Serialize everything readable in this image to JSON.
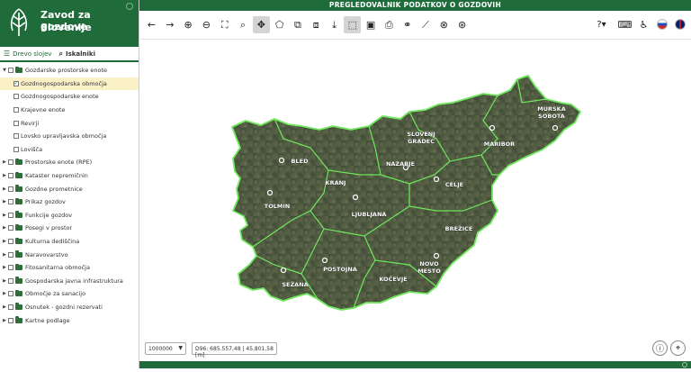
{
  "brand": {
    "line1": "Zavod za gozdove",
    "line2": "Slovenije"
  },
  "header_title": "PREGLEDOVALNIK PODATKOV O GOZDOVIH",
  "tabs": [
    {
      "label": "Drevo slojev",
      "icon": "tree-list-icon"
    },
    {
      "label": "Iskalniki",
      "icon": "search-icon"
    }
  ],
  "tree": [
    {
      "label": "Gozdarske prostorske enote",
      "kind": "group",
      "expanded": true
    },
    {
      "label": "Gozdnogospodarska območja",
      "kind": "layer",
      "checked": true,
      "selected": true
    },
    {
      "label": "Gozdnogospodarske enote",
      "kind": "layer",
      "checked": false
    },
    {
      "label": "Krajevne enote",
      "kind": "layer",
      "checked": false
    },
    {
      "label": "Revirji",
      "kind": "layer",
      "checked": false
    },
    {
      "label": "Lovsko upravljavska območja",
      "kind": "layer",
      "checked": false
    },
    {
      "label": "Lovišča",
      "kind": "layer",
      "checked": false
    },
    {
      "label": "Prostorske enote (RPE)",
      "kind": "group"
    },
    {
      "label": "Kataster nepremičnin",
      "kind": "group"
    },
    {
      "label": "Gozdne prometnice",
      "kind": "group"
    },
    {
      "label": "Prikaz gozdov",
      "kind": "group"
    },
    {
      "label": "Funkcije gozdov",
      "kind": "group"
    },
    {
      "label": "Posegi v prostor",
      "kind": "group"
    },
    {
      "label": "Kulturna dediščina",
      "kind": "group"
    },
    {
      "label": "Naravovarstvo",
      "kind": "group"
    },
    {
      "label": "Fitosanitarna območja",
      "kind": "group"
    },
    {
      "label": "Gospodarska javna infrastruktura",
      "kind": "group"
    },
    {
      "label": "Območje za sanacijo",
      "kind": "group"
    },
    {
      "label": "Osnutek - gozdni rezervati",
      "kind": "group"
    },
    {
      "label": "Kartne podlage",
      "kind": "group"
    }
  ],
  "toolbar": {
    "left": [
      {
        "name": "back-arrow-icon",
        "glyph": "←"
      },
      {
        "name": "forward-arrow-icon",
        "glyph": "→"
      },
      {
        "name": "zoom-in-icon",
        "glyph": "⊕"
      },
      {
        "name": "zoom-out-icon",
        "glyph": "⊖"
      },
      {
        "name": "full-extent-icon",
        "glyph": "⛶"
      },
      {
        "name": "zoom-to-box-icon",
        "glyph": "⌕"
      },
      {
        "name": "pan-icon",
        "glyph": "✥",
        "active": true
      },
      {
        "name": "select-polygon-icon",
        "glyph": "⬠"
      },
      {
        "name": "layers-stack-icon",
        "glyph": "⧉"
      },
      {
        "name": "layers-edit-icon",
        "glyph": "⧈"
      },
      {
        "name": "download-icon",
        "glyph": "⤓"
      },
      {
        "name": "box-select-icon",
        "glyph": "⬚",
        "active": true
      },
      {
        "name": "screen-capture-icon",
        "glyph": "▣"
      },
      {
        "name": "print-icon",
        "glyph": "⎙"
      },
      {
        "name": "link-icon",
        "glyph": "⚭"
      },
      {
        "name": "measure-icon",
        "glyph": "⟋"
      },
      {
        "name": "globe-icon",
        "glyph": "⊗"
      },
      {
        "name": "world-map-icon",
        "glyph": "⊛"
      }
    ],
    "right": [
      {
        "name": "help-icon",
        "glyph": "?",
        "dropdown": true
      },
      {
        "name": "keyboard-icon",
        "glyph": "⌨"
      },
      {
        "name": "accessibility-icon",
        "glyph": "♿"
      }
    ],
    "languages": [
      {
        "name": "slovenian-flag-icon",
        "color": "#1d4fbf"
      },
      {
        "name": "english-flag-icon",
        "color": "#c8102e"
      }
    ]
  },
  "map": {
    "region_labels": [
      {
        "text": "BLED"
      },
      {
        "text": "KRANJ"
      },
      {
        "text": "TOLMIN"
      },
      {
        "text": "LJUBLJANA"
      },
      {
        "text": "NAZARJE"
      },
      {
        "text": "SLOVENJ"
      },
      {
        "text": "GRADEC"
      },
      {
        "text": "MARIBOR"
      },
      {
        "text": "MURSKA"
      },
      {
        "text": "SOBOTA"
      },
      {
        "text": "CELJE"
      },
      {
        "text": "BREŽICE"
      },
      {
        "text": "NOVO"
      },
      {
        "text": "MESTO"
      },
      {
        "text": "POSTOJNA"
      },
      {
        "text": "SEŽANA"
      },
      {
        "text": "KOČEVJE"
      }
    ]
  },
  "bottom": {
    "scale_value": "1000000",
    "coords": "D96: 685.557,48 | 45.801,58 [m]",
    "info_icon": "info-icon",
    "locate_icon": "crosshair-icon"
  },
  "colors": {
    "brand_green": "#1f6b3a",
    "boundary_green": "#6ee85c",
    "selection": "#fbf1c6"
  }
}
